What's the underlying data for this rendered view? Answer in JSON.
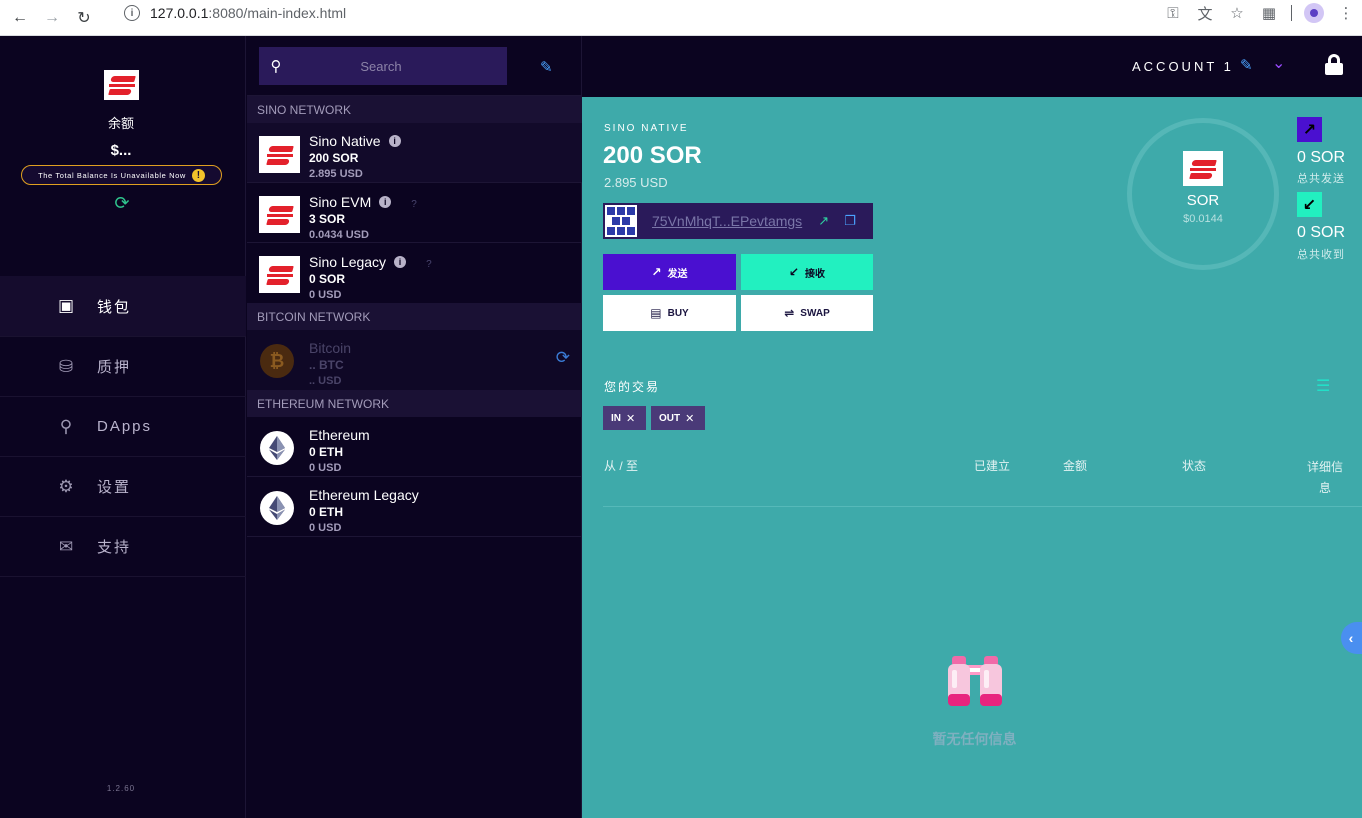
{
  "browser": {
    "url_host": "127.0.0.1",
    "url_rest": ":8080/main-index.html"
  },
  "sidebar": {
    "balance_label": "余额",
    "balance_value": "$...",
    "warning": "The Total Balance Is Unavailable Now",
    "nav": [
      {
        "label": "钱包",
        "icon": "wallet-icon"
      },
      {
        "label": "质押",
        "icon": "database-icon"
      },
      {
        "label": "DApps",
        "icon": "search-icon"
      },
      {
        "label": "设置",
        "icon": "gear-icon"
      },
      {
        "label": "支持",
        "icon": "chat-icon"
      }
    ],
    "version": "1.2.60"
  },
  "middle": {
    "search_placeholder": "Search",
    "networks": [
      {
        "name": "SINO NETWORK",
        "assets": [
          {
            "name": "Sino Native",
            "balance": "200 SOR",
            "usd": "2.895 USD"
          },
          {
            "name": "Sino EVM",
            "balance": "3 SOR",
            "usd": "0.0434 USD"
          },
          {
            "name": "Sino Legacy",
            "balance": "0 SOR",
            "usd": "0 USD"
          }
        ]
      },
      {
        "name": "BITCOIN NETWORK",
        "assets": [
          {
            "name": "Bitcoin",
            "balance": ".. BTC",
            "usd": ".. USD"
          }
        ]
      },
      {
        "name": "ETHEREUM NETWORK",
        "assets": [
          {
            "name": "Ethereum",
            "balance": "0 ETH",
            "usd": "0 USD"
          },
          {
            "name": "Ethereum Legacy",
            "balance": "0 ETH",
            "usd": "0 USD"
          }
        ]
      }
    ]
  },
  "topbar": {
    "account": "ACCOUNT 1"
  },
  "detail": {
    "network_label": "SINO NATIVE",
    "amount": "200 SOR",
    "usd": "2.895 USD",
    "address": "75VnMhqT...EPevtamgs",
    "send_label": "发送",
    "receive_label": "接收",
    "buy_label": "BUY",
    "swap_label": "SWAP",
    "token_symbol": "SOR",
    "token_price": "$0.0144",
    "total_sent": "0 SOR",
    "total_sent_label": "总共发送",
    "total_received": "0 SOR",
    "total_received_label": "总共收到",
    "tx_title": "您的交易",
    "filters": [
      "IN",
      "OUT"
    ],
    "columns": {
      "from_to": "从 / 至",
      "created": "已建立",
      "amount": "金额",
      "status": "状态",
      "details": "详细信息"
    },
    "empty": "暂无任何信息"
  },
  "colors": {
    "sidebar_bg": "#0b0420",
    "panel_bg": "#3eaaaa",
    "send": "#4a10d0",
    "receive": "#22f0c0",
    "brand_red": "#e3212b"
  }
}
